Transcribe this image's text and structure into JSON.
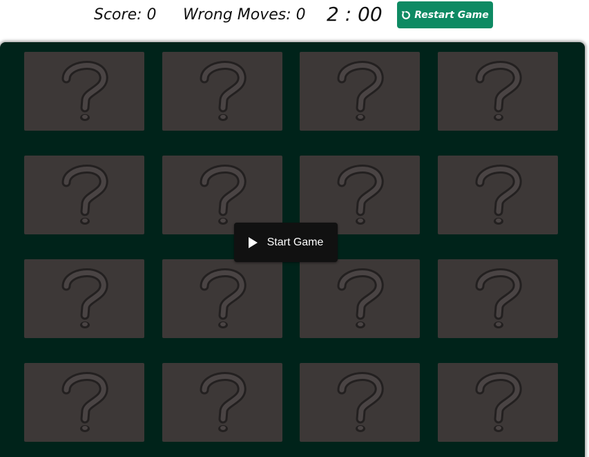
{
  "header": {
    "score_text": "Score: 0",
    "wrong_moves_text": "Wrong Moves: 0",
    "timer_text": "2 : 00",
    "restart_label": "Restart Game"
  },
  "board": {
    "cards": [
      {
        "face": "question-mark",
        "state": "hidden"
      },
      {
        "face": "question-mark",
        "state": "hidden"
      },
      {
        "face": "question-mark",
        "state": "hidden"
      },
      {
        "face": "question-mark",
        "state": "hidden"
      },
      {
        "face": "question-mark",
        "state": "hidden"
      },
      {
        "face": "question-mark",
        "state": "hidden"
      },
      {
        "face": "question-mark",
        "state": "hidden"
      },
      {
        "face": "question-mark",
        "state": "hidden"
      },
      {
        "face": "question-mark",
        "state": "hidden"
      },
      {
        "face": "question-mark",
        "state": "hidden"
      },
      {
        "face": "question-mark",
        "state": "hidden"
      },
      {
        "face": "question-mark",
        "state": "hidden"
      },
      {
        "face": "question-mark",
        "state": "hidden"
      },
      {
        "face": "question-mark",
        "state": "hidden"
      },
      {
        "face": "question-mark",
        "state": "hidden"
      },
      {
        "face": "question-mark",
        "state": "hidden"
      }
    ]
  },
  "overlay": {
    "start_label": "Start Game"
  },
  "icons": {
    "restart": "restart-icon",
    "play": "play-icon",
    "card_back": "question-mark-icon"
  },
  "colors": {
    "accent": "#0e8a63",
    "board_background": "#00231a",
    "card_background": "#3d3837",
    "start_button": "#111111"
  }
}
